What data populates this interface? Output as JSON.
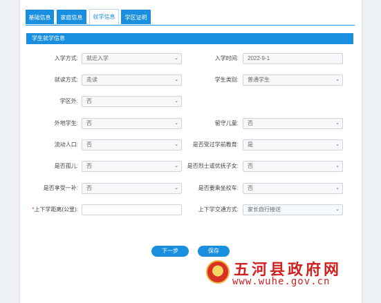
{
  "tabs": [
    "基础信息",
    "家庭信息",
    "就学信息",
    "学区证明"
  ],
  "active_tab": 2,
  "section_title": "学生就学信息",
  "fields": {
    "enroll_method": {
      "label": "入学方式:",
      "value": "就近入学"
    },
    "enroll_time": {
      "label": "入学时间:",
      "value": "2022-9-1"
    },
    "study_mode": {
      "label": "就读方式:",
      "value": "走读"
    },
    "student_type": {
      "label": "学生类别:",
      "value": "普通学生"
    },
    "out_of_district": {
      "label": "学区外:",
      "value": "否"
    },
    "out_of_town": {
      "label": "外地学生:",
      "value": "否"
    },
    "left_behind": {
      "label": "留守儿童:",
      "value": "否"
    },
    "migrant_population": {
      "label": "流动人口:",
      "value": "否"
    },
    "preschool_education": {
      "label": "是否受过学前教育:",
      "value": "是"
    },
    "orphan": {
      "label": "是否孤儿:",
      "value": "否"
    },
    "martyr_child": {
      "label": "是否烈士或优抚子女:",
      "value": "否"
    },
    "one_subsidy": {
      "label": "是否享受一补:",
      "value": "否"
    },
    "school_bus": {
      "label": "是否要乘坐校车:",
      "value": "否"
    },
    "commute_distance": {
      "label": "上下学距离(公里):",
      "value": "",
      "required_mark": "*"
    },
    "commute_method": {
      "label": "上下学交通方式:",
      "value": "家长自行接送"
    }
  },
  "buttons": {
    "next": "下一步",
    "save": "保存"
  },
  "watermark": {
    "title": "五河县政府网",
    "url": "www.wuhe.gov.cn"
  },
  "colors": {
    "primary": "#1a8fe0",
    "watermark": "#d21f1f"
  }
}
